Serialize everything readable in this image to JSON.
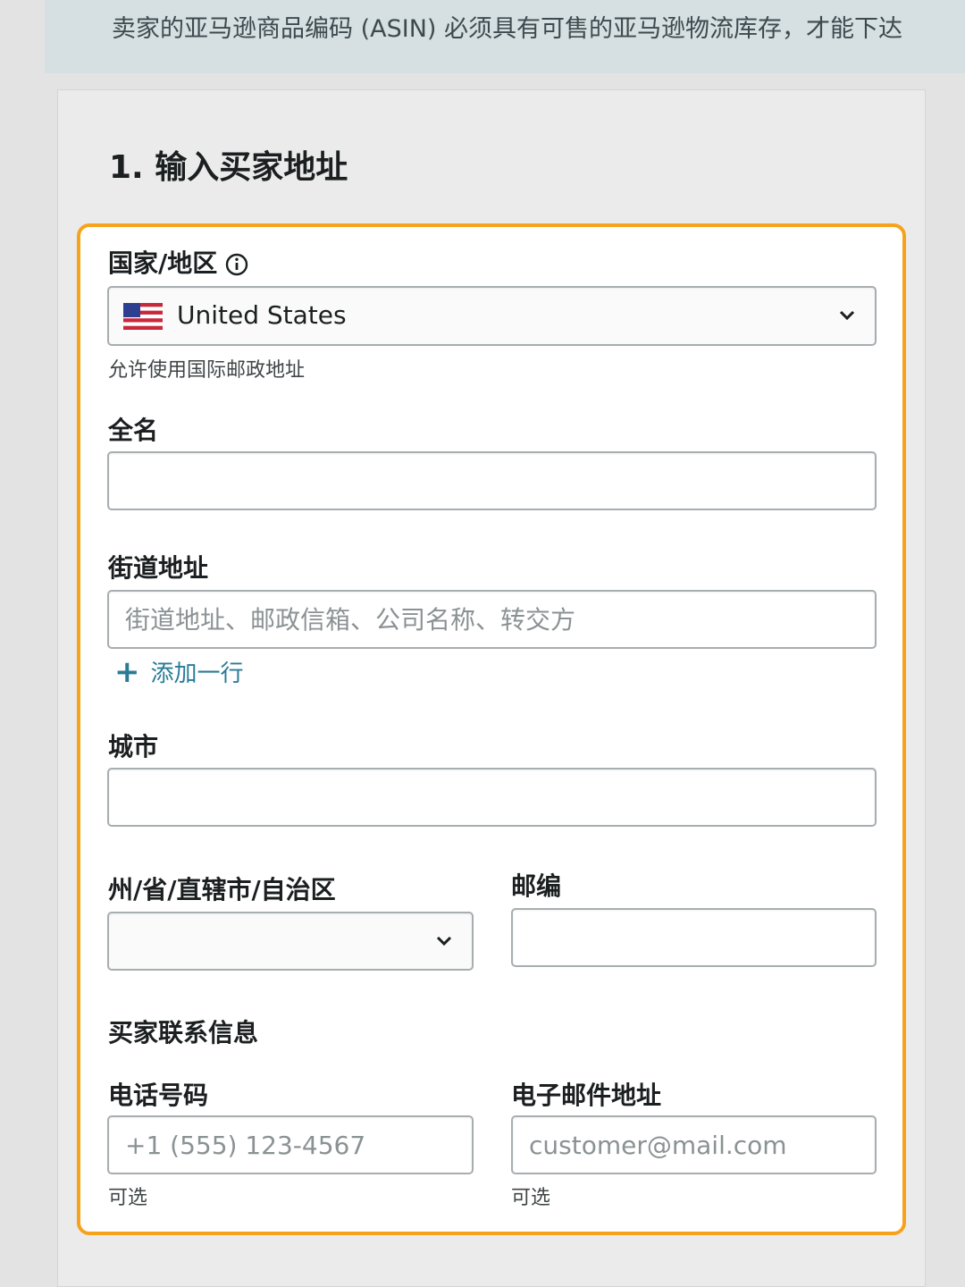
{
  "banner": {
    "text": "卖家的亚马逊商品编码 (ASIN) 必须具有可售的亚马逊物流库存，才能下达"
  },
  "section": {
    "title": "1. 输入买家地址"
  },
  "form": {
    "country": {
      "label": "国家/地区",
      "value": "United States",
      "hint": "允许使用国际邮政地址"
    },
    "full_name": {
      "label": "全名",
      "value": ""
    },
    "street": {
      "label": "街道地址",
      "placeholder": "街道地址、邮政信箱、公司名称、转交方",
      "add_line": "添加一行"
    },
    "city": {
      "label": "城市",
      "value": ""
    },
    "state": {
      "label": "州/省/直辖市/自治区",
      "value": ""
    },
    "zip": {
      "label": "邮编",
      "value": ""
    },
    "contact_heading": "买家联系信息",
    "phone": {
      "label": "电话号码",
      "placeholder": "+1 (555) 123-4567",
      "hint": "可选"
    },
    "email": {
      "label": "电子邮件地址",
      "placeholder": "customer@mail.com",
      "hint": "可选"
    }
  },
  "colors": {
    "highlight": "#f6a21b",
    "link": "#2a7c96",
    "banner_bg": "#d6dfe1"
  },
  "icons": {
    "info": "info-icon",
    "chevron": "chevron-down-icon",
    "flag": "us-flag-icon",
    "plus": "plus-icon"
  }
}
